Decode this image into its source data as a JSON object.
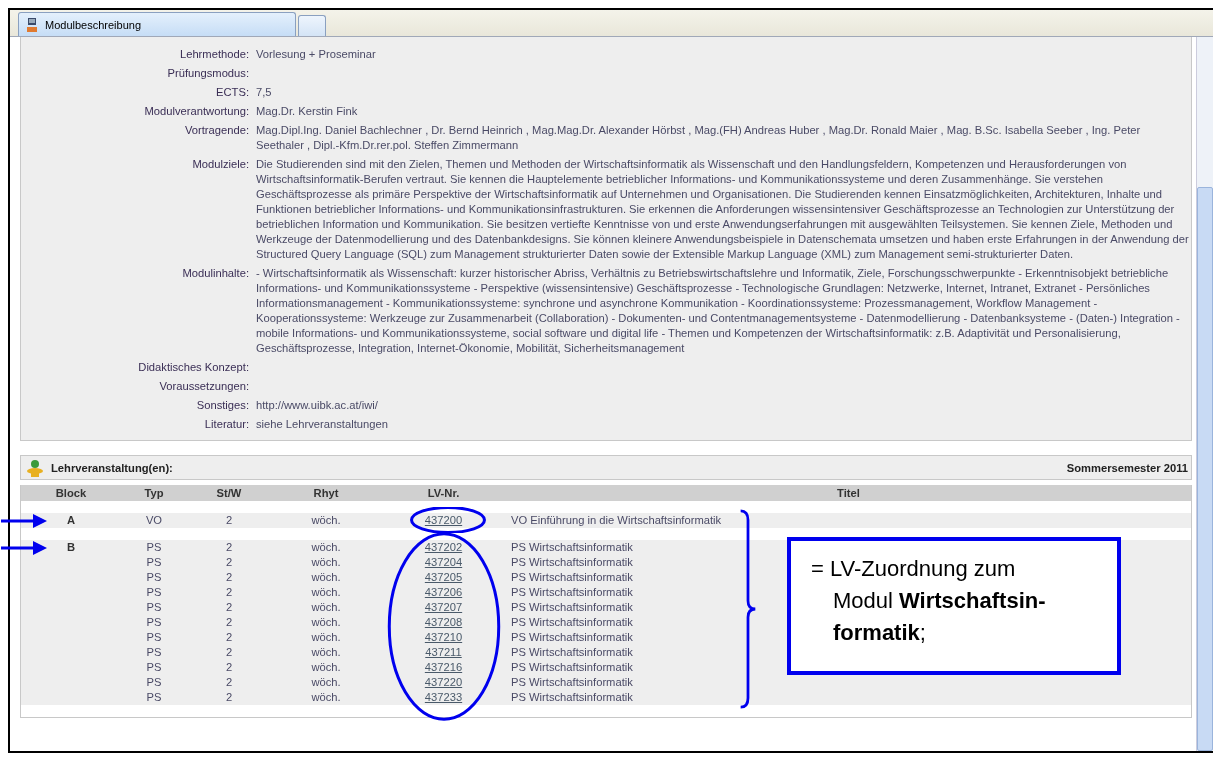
{
  "window": {
    "tab_title": "Modulbeschreibung"
  },
  "details": [
    {
      "label": "Lehrmethode:",
      "value": "Vorlesung + Proseminar"
    },
    {
      "label": "Prüfungsmodus:"
    },
    {
      "label": "ECTS:",
      "value": "7,5"
    },
    {
      "label": "Modulverantwortung:",
      "value": "Mag.Dr. Kerstin Fink"
    },
    {
      "label": "Vortragende:",
      "value": "Mag.Dipl.Ing. Daniel Bachlechner , Dr. Bernd Heinrich , Mag.Mag.Dr. Alexander Hörbst , Mag.(FH) Andreas Huber , Mag.Dr. Ronald Maier , Mag. B.Sc. Isabella Seeber , Ing. Peter Seethaler , Dipl.-Kfm.Dr.rer.pol. Steffen Zimmermann"
    },
    {
      "label": "Modulziele:",
      "value": "Die Studierenden sind mit den Zielen, Themen und Methoden der Wirtschaftsinformatik als Wissenschaft und den Handlungsfeldern, Kompetenzen und Herausforderungen von Wirtschaftsinformatik-Berufen vertraut. Sie kennen die Hauptelemente betrieblicher Informations- und Kommunikationssysteme und deren Zusammenhänge. Sie verstehen Geschäftsprozesse als primäre Perspektive der Wirtschaftsinformatik auf Unternehmen und Organisationen. Die Studierenden kennen Einsatzmöglichkeiten, Architekturen, Inhalte und Funktionen betrieblicher Informations- und Kommunikationsinfrastrukturen. Sie erkennen die Anforderungen wissensintensiver Geschäftsprozesse an Technologien zur Unterstützung der betrieblichen Information und Kommunikation. Sie besitzen vertiefte Kenntnisse von und erste Anwendungserfahrungen mit ausgewählten Teilsystemen. Sie kennen Ziele, Methoden und Werkzeuge der Datenmodellierung und des Datenbankdesigns. Sie können kleinere Anwendungsbeispiele in Datenschemata umsetzen und haben erste Erfahrungen in der Anwendung der Structured Query Language (SQL) zum Management strukturierter Daten sowie der Extensible Markup Language (XML) zum Management semi-strukturierter Daten."
    },
    {
      "label": "Modulinhalte:",
      "value": "- Wirtschaftsinformatik als Wissenschaft: kurzer historischer Abriss, Verhältnis zu Betriebswirtschaftslehre und Informatik, Ziele, Forschungsschwerpunkte - Erkenntnisobjekt betriebliche Informations- und Kommunikationssysteme - Perspektive (wissensintensive) Geschäftsprozesse - Technologische Grundlagen: Netzwerke, Internet, Intranet, Extranet - Persönliches Informationsmanagement - Kommunikationssysteme: synchrone und asynchrone Kommunikation - Koordinationssysteme: Prozessmanagement, Workflow Management - Kooperationssysteme: Werkzeuge zur Zusammenarbeit (Collaboration) - Dokumenten- und Contentmanagementsysteme - Datenmodellierung - Datenbanksysteme - (Daten-) Integration - mobile Informations- und Kommunikationssysteme, social software und digital life - Themen und Kompetenzen der Wirtschaftsinformatik: z.B. Adaptivität und Personalisierung, Geschäftsprozesse, Integration, Internet-Ökonomie, Mobilität, Sicherheitsmanagement"
    },
    {
      "label": "Didaktisches Konzept:"
    },
    {
      "label": "Voraussetzungen:"
    },
    {
      "label": "Sonstiges:",
      "value": "http://www.uibk.ac.at/iwi/"
    },
    {
      "label": "Literatur:",
      "value": "siehe Lehrveranstaltungen"
    }
  ],
  "courses": {
    "title": "Lehrveranstaltung(en):",
    "semester": "Sommersemester 2011",
    "columns": [
      "Block",
      "Typ",
      "St/W",
      "Rhyt",
      "LV-Nr.",
      "Titel"
    ],
    "blocks": [
      {
        "block": "A",
        "rows": [
          {
            "typ": "VO",
            "stw": "2",
            "rhyt": "wöch.",
            "lv_nr": "437200",
            "titel": "VO Einführung in die Wirtschaftsinformatik"
          }
        ]
      },
      {
        "block": "B",
        "rows": [
          {
            "typ": "PS",
            "stw": "2",
            "rhyt": "wöch.",
            "lv_nr": "437202",
            "titel": "PS Wirtschaftsinformatik"
          },
          {
            "typ": "PS",
            "stw": "2",
            "rhyt": "wöch.",
            "lv_nr": "437204",
            "titel": "PS Wirtschaftsinformatik"
          },
          {
            "typ": "PS",
            "stw": "2",
            "rhyt": "wöch.",
            "lv_nr": "437205",
            "titel": "PS Wirtschaftsinformatik"
          },
          {
            "typ": "PS",
            "stw": "2",
            "rhyt": "wöch.",
            "lv_nr": "437206",
            "titel": "PS Wirtschaftsinformatik"
          },
          {
            "typ": "PS",
            "stw": "2",
            "rhyt": "wöch.",
            "lv_nr": "437207",
            "titel": "PS Wirtschaftsinformatik"
          },
          {
            "typ": "PS",
            "stw": "2",
            "rhyt": "wöch.",
            "lv_nr": "437208",
            "titel": "PS Wirtschaftsinformatik"
          },
          {
            "typ": "PS",
            "stw": "2",
            "rhyt": "wöch.",
            "lv_nr": "437210",
            "titel": "PS Wirtschaftsinformatik"
          },
          {
            "typ": "PS",
            "stw": "2",
            "rhyt": "wöch.",
            "lv_nr": "437211",
            "titel": "PS Wirtschaftsinformatik"
          },
          {
            "typ": "PS",
            "stw": "2",
            "rhyt": "wöch.",
            "lv_nr": "437216",
            "titel": "PS Wirtschaftsinformatik"
          },
          {
            "typ": "PS",
            "stw": "2",
            "rhyt": "wöch.",
            "lv_nr": "437220",
            "titel": "PS Wirtschaftsinformatik"
          },
          {
            "typ": "PS",
            "stw": "2",
            "rhyt": "wöch.",
            "lv_nr": "437233",
            "titel": "PS Wirtschaftsinformatik"
          }
        ]
      }
    ]
  },
  "annotation": {
    "callout": "= LV-Zuordnung zum Modul **Wirtschaftsin-formatik**;"
  }
}
